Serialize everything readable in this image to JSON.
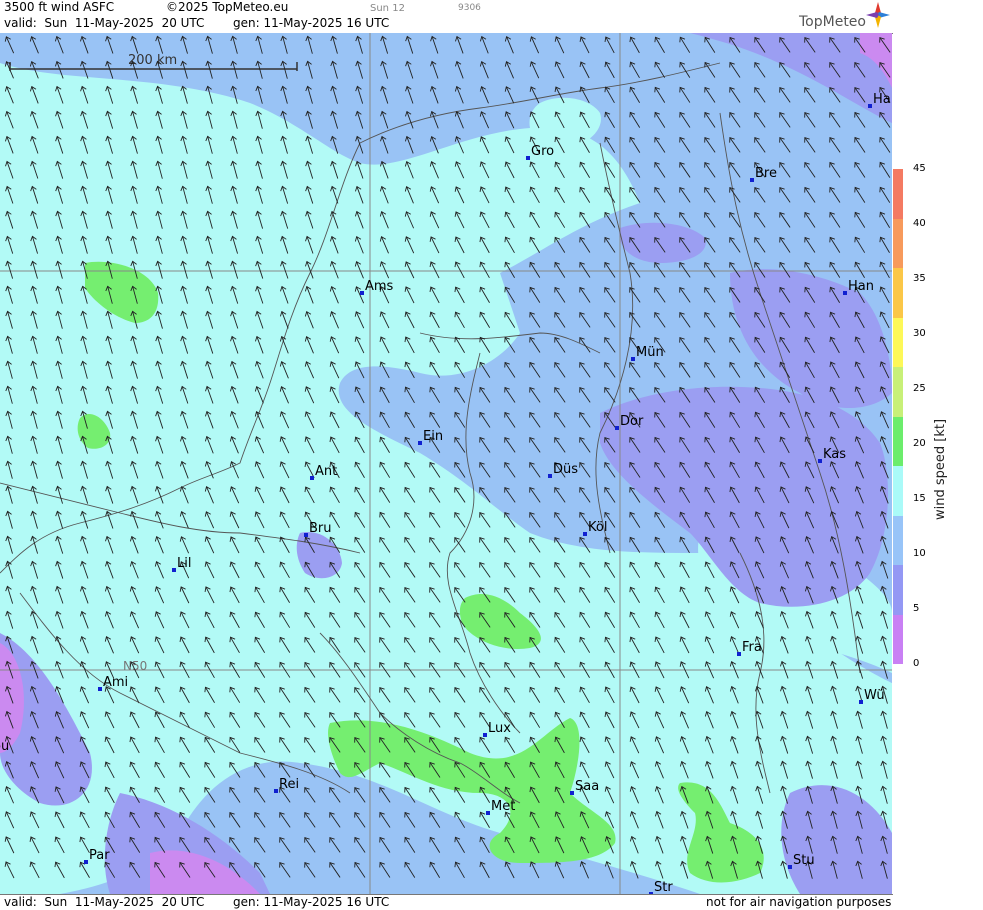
{
  "header": {
    "product": "3500 ft wind ASFC",
    "copyright": "©2025 TopMeteo.eu",
    "valid": "valid:  Sun  11-May-2025  20 UTC",
    "gen": "gen: 11-May-2025 16 UTC",
    "day": "Sun 12",
    "code": "9306",
    "brand": "TopMeteo"
  },
  "footer": {
    "valid": "valid:  Sun  11-May-2025  20 UTC",
    "gen": "gen: 11-May-2025 16 UTC",
    "note": "not for air navigation purposes"
  },
  "map": {
    "scale_label": "200 km",
    "lat_label": "N50",
    "cities": [
      {
        "name": "Gro"
      },
      {
        "name": "Bre"
      },
      {
        "name": "Ha"
      },
      {
        "name": "Ams"
      },
      {
        "name": "Han"
      },
      {
        "name": "Mün"
      },
      {
        "name": "Ein"
      },
      {
        "name": "Dor"
      },
      {
        "name": "Ant"
      },
      {
        "name": "Düs"
      },
      {
        "name": "Kas"
      },
      {
        "name": "Köl"
      },
      {
        "name": "Bru"
      },
      {
        "name": "Lil"
      },
      {
        "name": "Fra"
      },
      {
        "name": "Ami"
      },
      {
        "name": "Wü"
      },
      {
        "name": "Lux"
      },
      {
        "name": "ou"
      },
      {
        "name": "Rei"
      },
      {
        "name": "Saa"
      },
      {
        "name": "Met"
      },
      {
        "name": "Par"
      },
      {
        "name": "Stu"
      },
      {
        "name": "Str"
      }
    ]
  },
  "legend": {
    "title": "wind speed [kt]",
    "ticks": [
      "45",
      "40",
      "35",
      "30",
      "25",
      "20",
      "15",
      "10",
      "5",
      "0"
    ],
    "colors": [
      "#f47a62",
      "#f79a5c",
      "#fbc748",
      "#fdf858",
      "#c8f078",
      "#6ced6c",
      "#aafaf8",
      "#98c4f8",
      "#9498f4",
      "#c980f4"
    ]
  },
  "colors": {
    "wind_5_10": "#9b9ef2",
    "wind_10_15": "#99c3f5",
    "wind_15_20": "#b2faf6",
    "wind_20_25": "#75ee70",
    "wind_0_5": "#cb8af0"
  }
}
